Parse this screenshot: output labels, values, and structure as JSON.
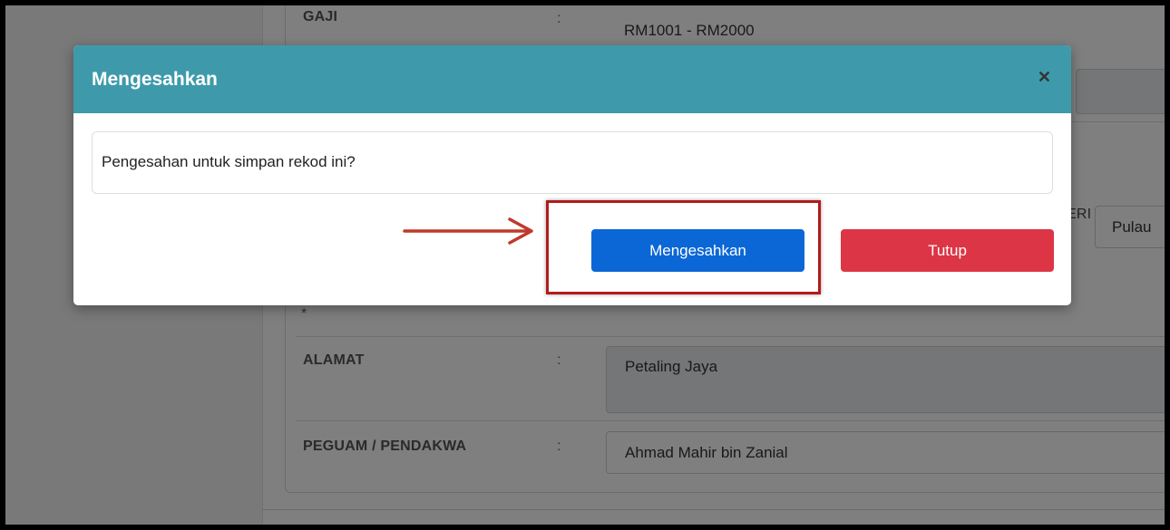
{
  "form": {
    "gaji_label": "GAJI",
    "gaji_value": "RM1001 - RM2000",
    "negeri_fragment": "ERI",
    "negeri_value": "Pulau",
    "required_marker": "*",
    "alamat_label": "ALAMAT",
    "alamat_value": "Petaling Jaya",
    "peguam_label": "PEGUAM / PENDAKWA",
    "peguam_value": "Ahmad Mahir bin Zanial",
    "colon": ":"
  },
  "modal": {
    "title": "Mengesahkan",
    "close_icon": "close-icon",
    "message": "Pengesahan untuk simpan rekod ini?",
    "confirm_label": "Mengesahkan",
    "close_label": "Tutup"
  },
  "colors": {
    "header": "#3e9aab",
    "confirm": "#0b67d6",
    "close": "#dc3545",
    "annotation": "#b11c1c"
  }
}
